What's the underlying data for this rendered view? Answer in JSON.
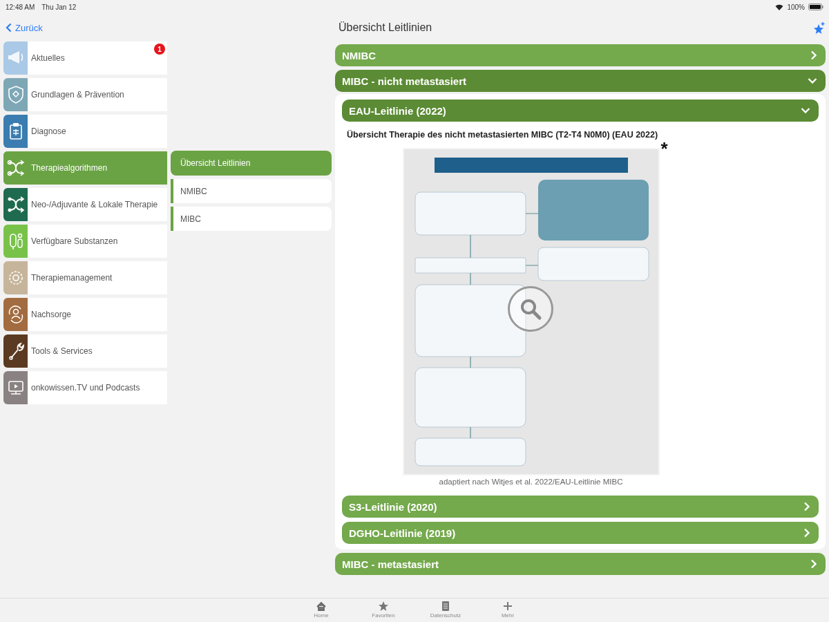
{
  "status_bar": {
    "time": "12:48 AM",
    "date": "Thu Jan 12",
    "battery": "100%"
  },
  "nav": {
    "back": "Zurück",
    "title": "Übersicht Leitlinien"
  },
  "sidebar": {
    "items": [
      {
        "label": "Aktuelles",
        "color": "#a9c9e6",
        "selected": false,
        "badge": "1"
      },
      {
        "label": "Grundlagen & Prävention",
        "color": "#7ea7b6",
        "selected": false
      },
      {
        "label": "Diagnose",
        "color": "#3b7db0",
        "selected": false
      },
      {
        "label": "Therapiealgorithmen",
        "color": "#6aa344",
        "selected": true
      },
      {
        "label": "Neo-/Adjuvante & Lokale Therapie",
        "color": "#1e6b4f",
        "selected": false
      },
      {
        "label": "Verfügbare Substanzen",
        "color": "#79c24a",
        "selected": false
      },
      {
        "label": "Therapiemanagement",
        "color": "#c6b59b",
        "selected": false
      },
      {
        "label": "Nachsorge",
        "color": "#a26c40",
        "selected": false
      },
      {
        "label": "Tools & Services",
        "color": "#5b3a22",
        "selected": false
      },
      {
        "label": "onkowissen.TV und Podcasts",
        "color": "#8a8282",
        "selected": false
      }
    ]
  },
  "submenu": {
    "items": [
      {
        "label": "Übersicht Leitlinien",
        "selected": true
      },
      {
        "label": "NMIBC",
        "selected": false
      },
      {
        "label": "MIBC",
        "selected": false
      }
    ]
  },
  "sections": [
    {
      "title": "NMIBC",
      "expanded": false
    },
    {
      "title": "MIBC - nicht metastasiert",
      "expanded": true,
      "children": [
        {
          "title": "EAU-Leitlinie (2022)",
          "expanded": true,
          "heading": "Übersicht Therapie des nicht metastasierten MIBC (T2-T4 N0M0) (EAU 2022)",
          "figure": {
            "kind": "picture",
            "mark": "*",
            "caption": "adaptiert nach Witjes et al. 2022/EAU-Leitlinie MIBC"
          }
        },
        {
          "title": "S3-Leitlinie (2020)",
          "expanded": false
        },
        {
          "title": "DGHO-Leitlinie (2019)",
          "expanded": false
        }
      ]
    },
    {
      "title": "MIBC - metastasiert",
      "expanded": false
    }
  ],
  "tab_bar": {
    "items": [
      {
        "label": "Home"
      },
      {
        "label": "Favoriten"
      },
      {
        "label": "Datenschutz"
      },
      {
        "label": "Mehr"
      }
    ]
  }
}
